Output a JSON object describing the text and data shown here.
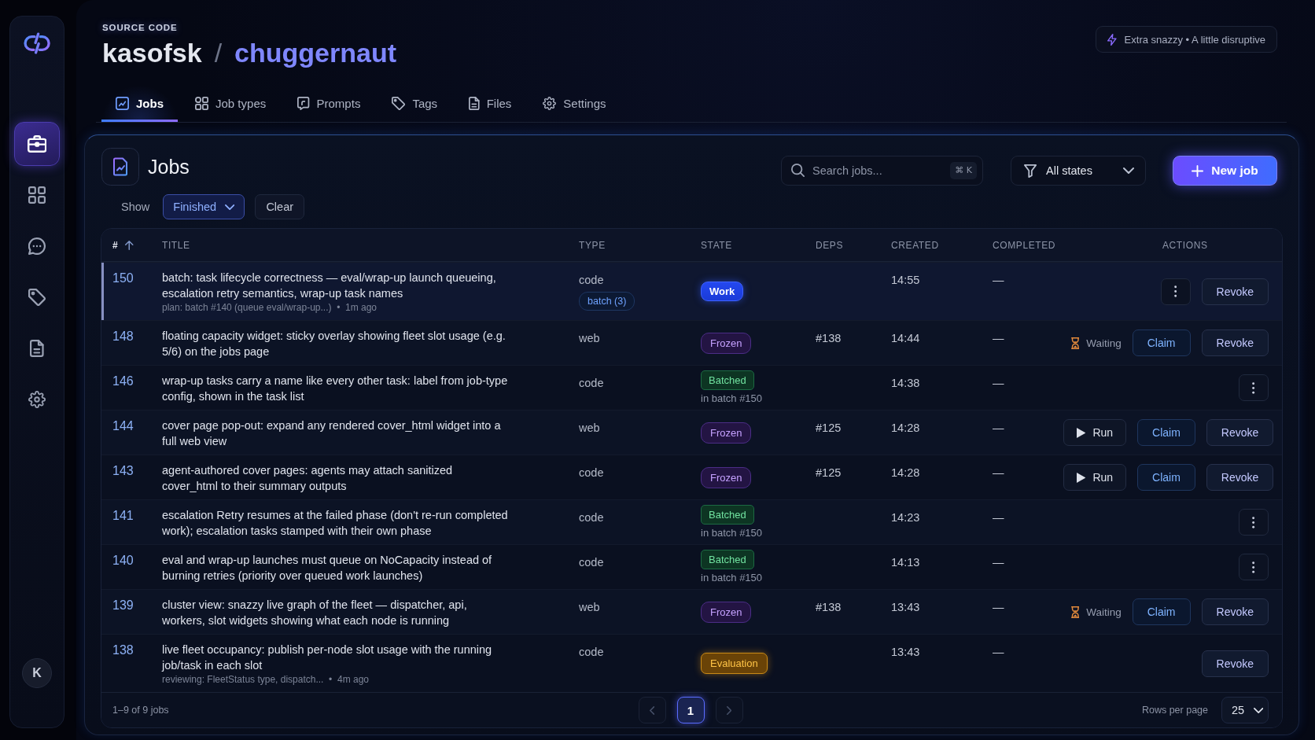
{
  "sidebar": {
    "items": [
      {
        "selected": true
      },
      {
        "selected": false
      },
      {
        "selected": false
      },
      {
        "selected": false
      },
      {
        "selected": false
      },
      {
        "selected": false
      }
    ],
    "avatar": {
      "initial": "K"
    }
  },
  "header": {
    "eyebrow": "SOURCE CODE",
    "owner": "kasofsk",
    "separator": "/",
    "repo": "chuggernaut",
    "mode_badge": "Extra snazzy • A little disruptive"
  },
  "tabs": [
    {
      "label": "Jobs",
      "selected": true
    },
    {
      "label": "Job types",
      "selected": false
    },
    {
      "label": "Prompts",
      "selected": false
    },
    {
      "label": "Tags",
      "selected": false
    },
    {
      "label": "Files",
      "selected": false
    },
    {
      "label": "Settings",
      "selected": false
    }
  ],
  "panel": {
    "title": "Jobs",
    "search": {
      "placeholder": "Search jobs...",
      "shortcut": "⌘ K"
    },
    "state_filter": {
      "value": "All states"
    },
    "new_button": {
      "label": "New job"
    },
    "show_filter": {
      "label": "Show",
      "value": "Finished",
      "clear": "Clear"
    },
    "table": {
      "columns": [
        {
          "label": "#",
          "sorted": true
        },
        {
          "label": "TITLE",
          "sorted": false
        },
        {
          "label": "TYPE",
          "sorted": false
        },
        {
          "label": "STATE",
          "sorted": false
        },
        {
          "label": "DEPS",
          "sorted": false
        },
        {
          "label": "CREATED",
          "sorted": false
        },
        {
          "label": "COMPLETED",
          "sorted": false
        },
        {
          "label": "ACTIONS",
          "sorted": false
        }
      ],
      "rows": [
        {
          "id": "150",
          "title": "batch: task lifecycle correctness — eval/wrap-up launch queueing, escalation retry semantics, wrap-up task names",
          "note": "plan: batch #140 (queue eval/wrap-up...)  •  1m ago",
          "type": "code",
          "type_tag": "batch (3)",
          "state": {
            "label": "Work",
            "kind": "work"
          },
          "created": "14:55",
          "completed": "—",
          "actions": [
            {
              "kind": "menu"
            },
            {
              "kind": "revoke",
              "label": "Revoke"
            }
          ],
          "selected": true
        },
        {
          "id": "148",
          "title": "floating capacity widget: sticky overlay showing fleet slot usage (e.g. 5/6) on the jobs page",
          "type": "web",
          "state": {
            "label": "Frozen",
            "kind": "frozen"
          },
          "deps": "#138",
          "created": "14:44",
          "completed": "—",
          "actions": [
            {
              "kind": "status",
              "label": "Waiting"
            },
            {
              "kind": "claim",
              "label": "Claim"
            },
            {
              "kind": "revoke",
              "label": "Revoke"
            }
          ],
          "selected": false
        },
        {
          "id": "146",
          "title": "wrap-up tasks carry a name like every other task: label from job-type config, shown in the task list",
          "type": "code",
          "state": {
            "label": "Batched",
            "kind": "batched",
            "note": "in batch #150"
          },
          "created": "14:38",
          "completed": "—",
          "actions": [
            {
              "kind": "menu"
            }
          ],
          "selected": false
        },
        {
          "id": "144",
          "title": "cover page pop-out: expand any rendered cover_html widget into a full web view",
          "type": "web",
          "state": {
            "label": "Frozen",
            "kind": "frozen"
          },
          "deps": "#125",
          "created": "14:28",
          "completed": "—",
          "actions": [
            {
              "kind": "run",
              "label": "Run"
            },
            {
              "kind": "claim",
              "label": "Claim"
            },
            {
              "kind": "revoke",
              "label": "Revoke"
            }
          ],
          "selected": false
        },
        {
          "id": "143",
          "title": "agent-authored cover pages: agents may attach sanitized cover_html to their summary outputs",
          "type": "code",
          "state": {
            "label": "Frozen",
            "kind": "frozen"
          },
          "deps": "#125",
          "created": "14:28",
          "completed": "—",
          "actions": [
            {
              "kind": "run",
              "label": "Run"
            },
            {
              "kind": "claim",
              "label": "Claim"
            },
            {
              "kind": "revoke",
              "label": "Revoke"
            }
          ],
          "selected": false
        },
        {
          "id": "141",
          "title": "escalation Retry resumes at the failed phase (don't re-run completed work); escalation tasks stamped with their own phase",
          "type": "code",
          "state": {
            "label": "Batched",
            "kind": "batched",
            "note": "in batch #150"
          },
          "created": "14:23",
          "completed": "—",
          "actions": [
            {
              "kind": "menu"
            }
          ],
          "selected": false
        },
        {
          "id": "140",
          "title": "eval and wrap-up launches must queue on NoCapacity instead of burning retries (priority over queued work launches)",
          "type": "code",
          "state": {
            "label": "Batched",
            "kind": "batched",
            "note": "in batch #150"
          },
          "created": "14:13",
          "completed": "—",
          "actions": [
            {
              "kind": "menu"
            }
          ],
          "selected": false
        },
        {
          "id": "139",
          "title": "cluster view: snazzy live graph of the fleet — dispatcher, api, workers, slot widgets showing what each node is running",
          "type": "web",
          "state": {
            "label": "Frozen",
            "kind": "frozen"
          },
          "deps": "#138",
          "created": "13:43",
          "completed": "—",
          "actions": [
            {
              "kind": "status",
              "label": "Waiting"
            },
            {
              "kind": "claim",
              "label": "Claim"
            },
            {
              "kind": "revoke",
              "label": "Revoke"
            }
          ],
          "selected": false
        },
        {
          "id": "138",
          "title": "live fleet occupancy: publish per-node slot usage with the running job/task in each slot",
          "note": "reviewing: FleetStatus type, dispatch...  •  4m ago",
          "type": "code",
          "state": {
            "label": "Evaluation",
            "kind": "evaluation"
          },
          "created": "13:43",
          "completed": "—",
          "actions": [
            {
              "kind": "revoke",
              "label": "Revoke"
            }
          ],
          "selected": false
        }
      ],
      "footer": {
        "summary": "1–9 of 9 jobs",
        "prev": {
          "disabled": true
        },
        "pages": [
          {
            "label": "1",
            "selected": true
          }
        ],
        "next": {
          "disabled": true
        },
        "rows_per_page": {
          "label": "Rows per page",
          "value": "25"
        }
      }
    }
  }
}
